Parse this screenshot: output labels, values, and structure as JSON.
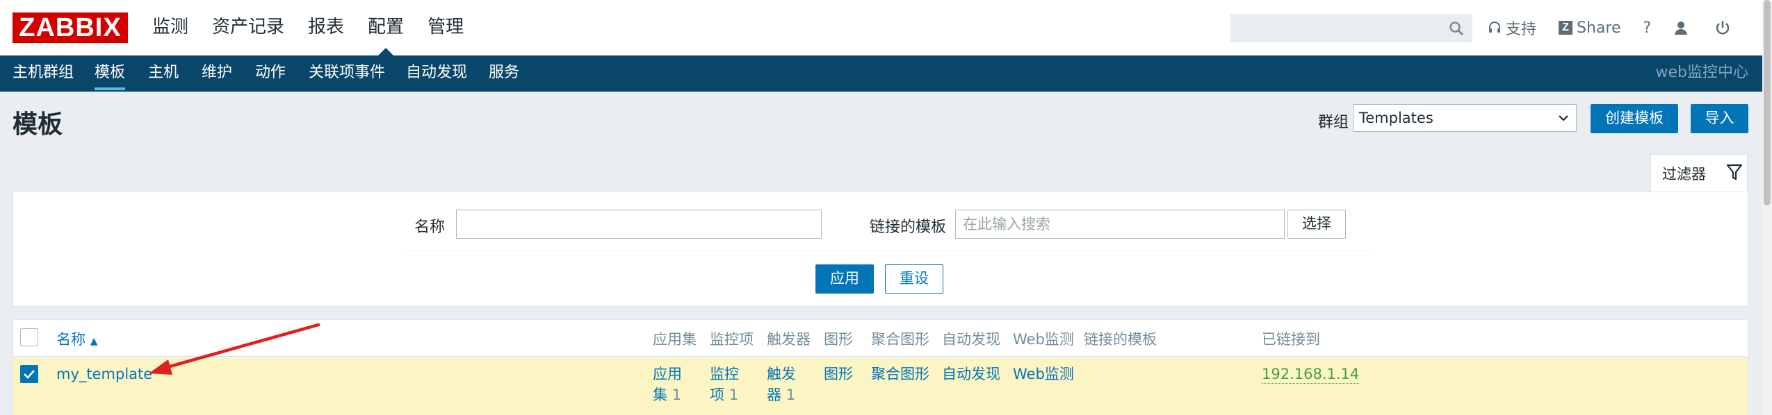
{
  "brand": {
    "logo_text": "ZABBIX",
    "accent": "#d40000"
  },
  "main_menu": [
    {
      "label": "监测"
    },
    {
      "label": "资产记录"
    },
    {
      "label": "报表"
    },
    {
      "label": "配置",
      "active": true
    },
    {
      "label": "管理"
    }
  ],
  "top_tools": {
    "support_label": "支持",
    "share_label": "Share",
    "help_label": "?"
  },
  "sub_menu": [
    {
      "label": "主机群组"
    },
    {
      "label": "模板",
      "active": true
    },
    {
      "label": "主机"
    },
    {
      "label": "维护"
    },
    {
      "label": "动作"
    },
    {
      "label": "关联项事件"
    },
    {
      "label": "自动发现"
    },
    {
      "label": "服务"
    }
  ],
  "sub_menu_right": "web监控中心",
  "page": {
    "title": "模板",
    "group_label": "群组",
    "group_selected": "Templates",
    "create_button": "创建模板",
    "import_button": "导入"
  },
  "filter": {
    "tab_label": "过滤器",
    "name_label": "名称",
    "name_value": "",
    "linked_label": "链接的模板",
    "linked_placeholder": "在此输入搜索",
    "select_button": "选择",
    "apply_button": "应用",
    "reset_button": "重设"
  },
  "table": {
    "headers": {
      "name": "名称",
      "sort_indicator": "▲",
      "applications": "应用集",
      "items": "监控项",
      "triggers": "触发器",
      "graphs": "图形",
      "screens": "聚合图形",
      "discovery": "自动发现",
      "web": "Web监测",
      "linked_templates": "链接的模板",
      "linked_to": "已链接到"
    },
    "rows": [
      {
        "checked": true,
        "name": "my_template",
        "applications": {
          "label_line1": "应用",
          "label_line2": "集",
          "count": "1"
        },
        "items": {
          "label_line1": "监控",
          "label_line2": "项",
          "count": "1"
        },
        "triggers": {
          "label_line1": "触发",
          "label_line2": "器",
          "count": "1"
        },
        "graphs": "图形",
        "screens": "聚合图形",
        "discovery": "自动发现",
        "web": "Web监测",
        "linked_to": "192.168.1.14"
      }
    ]
  },
  "colors": {
    "nav_bg": "#0a466a",
    "primary_blue": "#0275b8",
    "selected_row": "#fbf5c4",
    "annotation_arrow": "#e02020"
  }
}
